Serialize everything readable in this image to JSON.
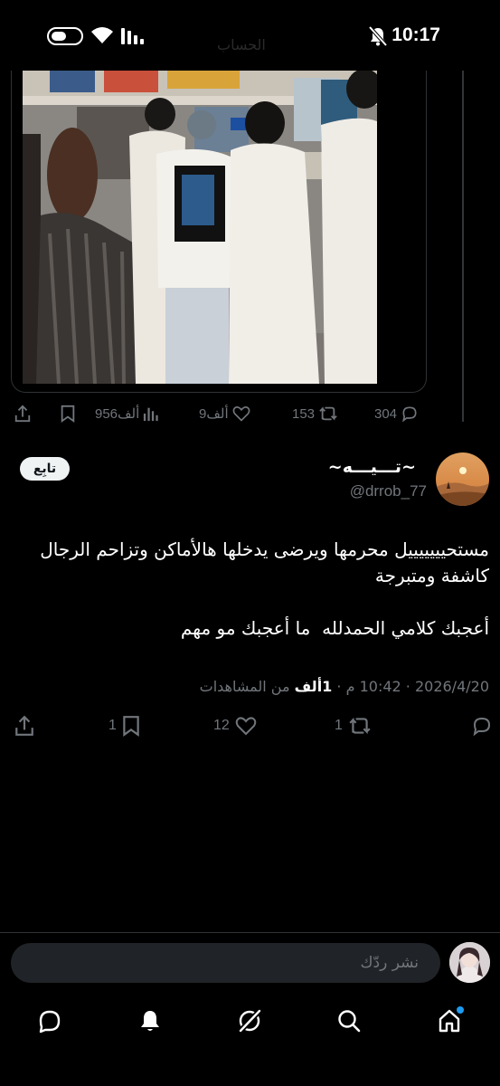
{
  "status_bar": {
    "time": "10:17",
    "ghost_text": "الحساب",
    "icons": [
      "battery-icon",
      "wifi-icon",
      "signal-icon",
      "bell-off-icon"
    ]
  },
  "previous_tweet": {
    "actions": {
      "replies": "304",
      "reposts": "153",
      "likes": "9ألف",
      "views": "956ألف"
    }
  },
  "tweet": {
    "display_name": "~تـــيـــه~",
    "handle": "@drrob_77",
    "follow_label": "تابِع",
    "text": "مستحيييييييل محرمها ويرضى يدخلها هالأماكن وتزاحم الرجال كاشفة ومتبرجة\n\nأعجبك كلامي الحمدلله  ما أعجبك مو مهم",
    "date": "2026/4/20",
    "time": "10:42 م",
    "views_count": "1ألف",
    "views_label": "من المشاهدات",
    "actions": {
      "replies": "",
      "reposts": "1",
      "likes": "12",
      "bookmarks": "1"
    }
  },
  "reply_bar": {
    "placeholder": "نشر ردّك"
  },
  "bottom_nav": {
    "items": [
      "home-icon",
      "search-icon",
      "grok-icon",
      "notifications-icon",
      "messages-icon"
    ],
    "accent": "#1d9bf0"
  },
  "colors": {
    "background": "#000000",
    "muted_text": "#71767b",
    "primary_text": "#e7e9ea",
    "accent": "#1d9bf0"
  }
}
